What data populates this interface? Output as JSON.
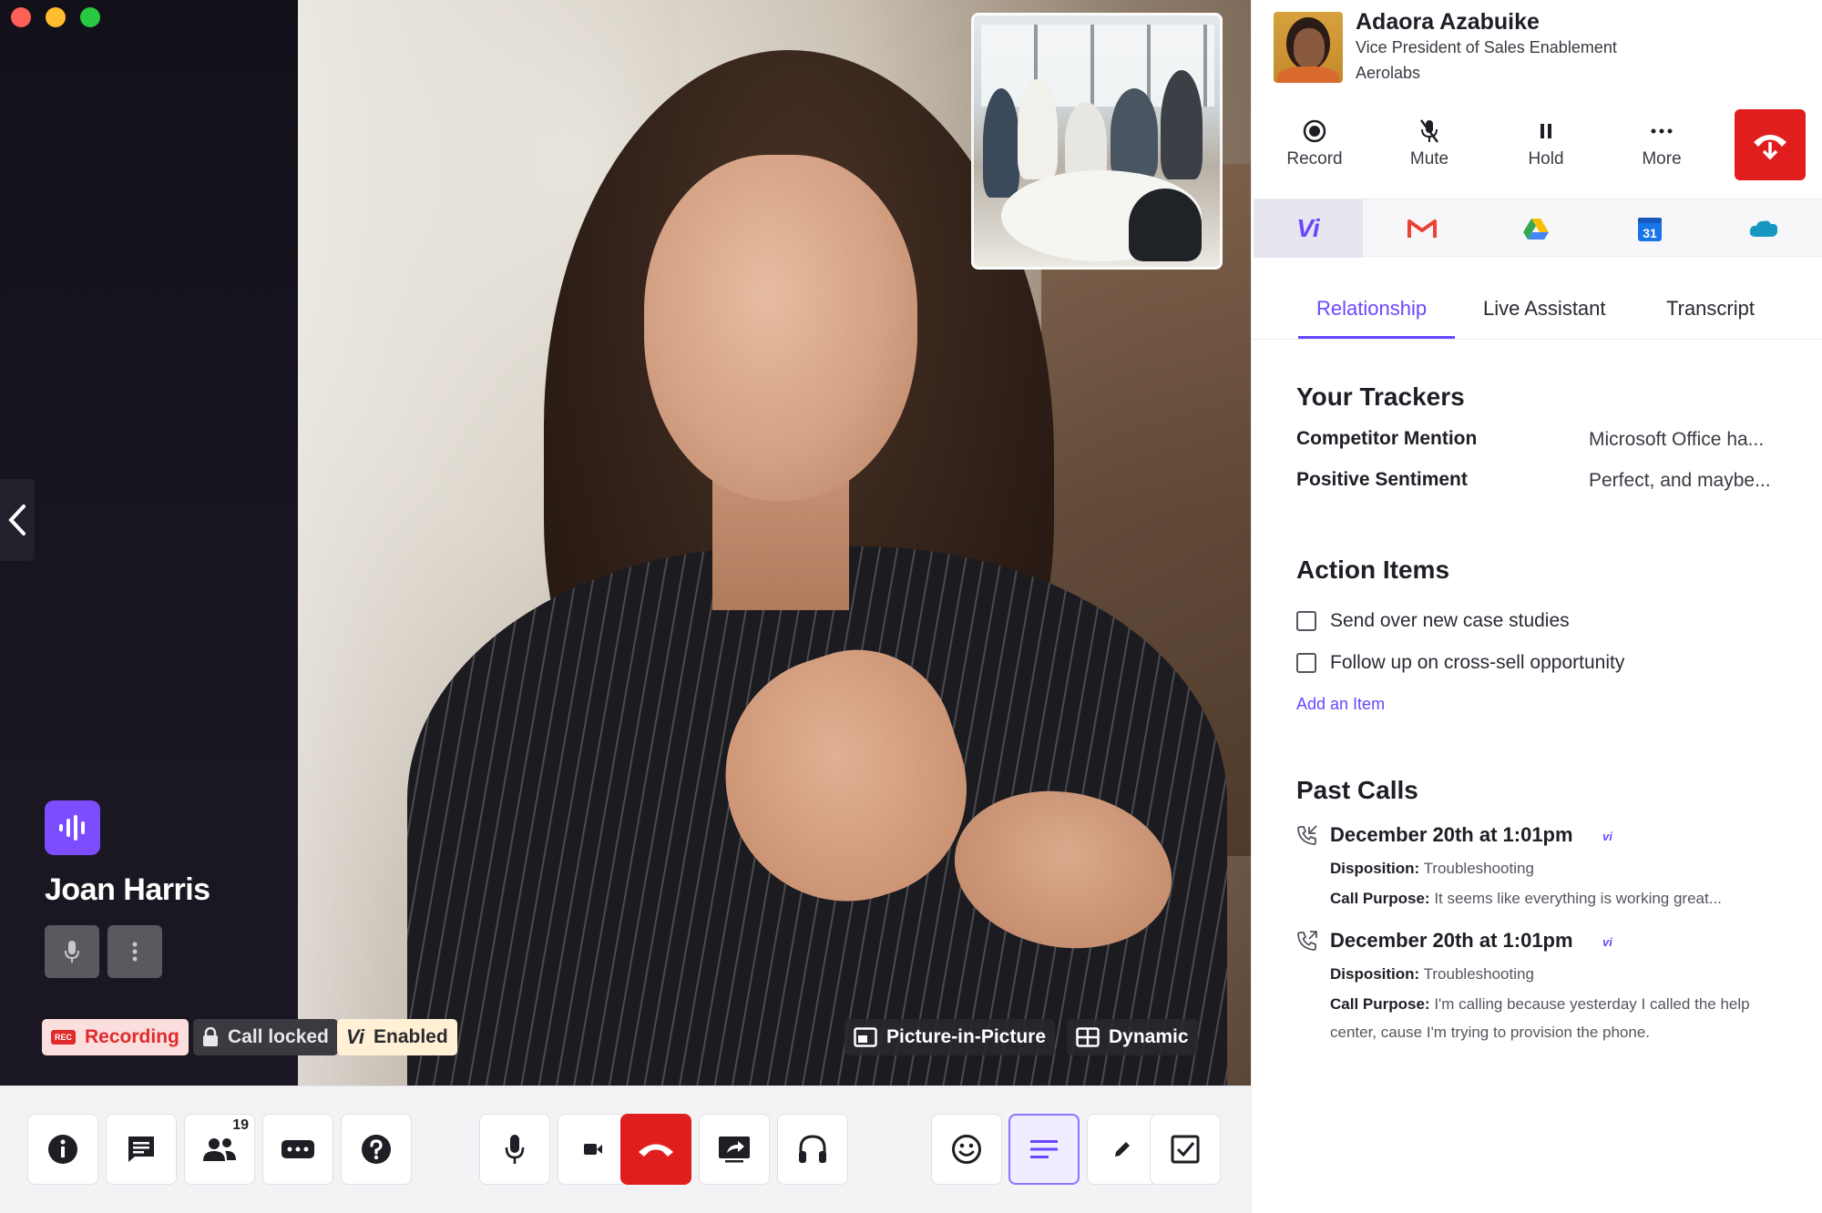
{
  "caller": {
    "name": "Joan Harris"
  },
  "status_pills": {
    "recording": "Recording",
    "rec_mark": "REC",
    "call_locked": "Call locked",
    "vi_mark": "Vi",
    "vi_enabled": "Enabled",
    "picture_in_picture": "Picture-in-Picture",
    "dynamic": "Dynamic"
  },
  "toolbar": {
    "participants_count": "19"
  },
  "contact": {
    "name": "Adaora Azabuike",
    "title": "Vice President of Sales Enablement",
    "company": "Aerolabs"
  },
  "call_controls": {
    "record": "Record",
    "mute": "Mute",
    "hold": "Hold",
    "more": "More"
  },
  "integrations": {
    "vi_label": "Vi",
    "calendar_day": "31"
  },
  "tabs": [
    {
      "label": "Relationship"
    },
    {
      "label": "Live Assistant"
    },
    {
      "label": "Transcript"
    }
  ],
  "trackers": {
    "title": "Your Trackers",
    "items": [
      {
        "label": "Competitor Mention",
        "value": "Microsoft Office ha..."
      },
      {
        "label": "Positive Sentiment",
        "value": "Perfect, and maybe..."
      }
    ]
  },
  "action_items": {
    "title": "Action Items",
    "items": [
      {
        "text": "Send over new case studies"
      },
      {
        "text": "Follow up on cross-sell opportunity"
      }
    ],
    "add_label": "Add an Item"
  },
  "past_calls": {
    "title": "Past Calls",
    "vi_tag": "vi",
    "disposition_label": "Disposition:",
    "purpose_label": "Call Purpose:",
    "items": [
      {
        "date": "December 20th at 1:01pm",
        "disposition": "Troubleshooting",
        "purpose": "It seems like everything is working great..."
      },
      {
        "date": "December 20th at 1:01pm",
        "disposition": "Troubleshooting",
        "purpose": "I'm calling because yesterday I called the help center, cause I'm trying to provision the phone."
      }
    ]
  },
  "colors": {
    "accent": "#6b46ff",
    "hangup": "#e01e1e",
    "caller_badge": "#7c4dff"
  }
}
